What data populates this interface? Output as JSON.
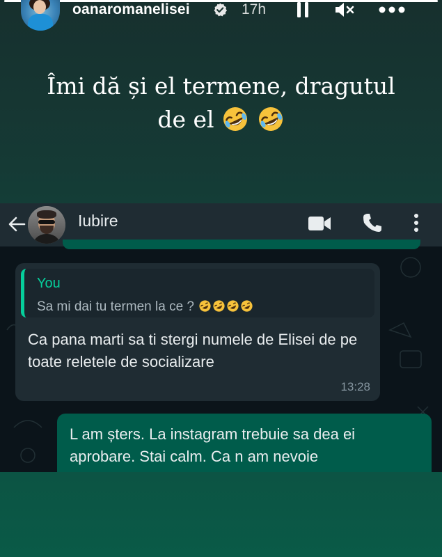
{
  "story": {
    "progress": 1.0,
    "username": "oanaromanelisei",
    "time": "17h",
    "caption_line1": "Îmi dă și el termene, dragutul",
    "caption_line2": "de el",
    "caption_emoji": "rolling-on-floor-laughing"
  },
  "icons": {
    "verified": "verified-badge-icon",
    "pause": "pause-icon",
    "mute": "mute-icon",
    "more": "more-icon"
  },
  "whatsapp": {
    "contact_name": "Iubire",
    "quote": {
      "author": "You",
      "text": "Sa mi dai tu termen la ce ?"
    },
    "incoming": {
      "text": "Ca pana marti sa ti stergi numele de Elisei de pe toate reletele de socializare",
      "time": "13:28"
    },
    "outgoing": {
      "text": "L am șters. La instagram trebuie sa dea ei aprobare. Stai calm. Ca n am nevoie"
    }
  },
  "colors": {
    "accent_green": "#06cf9c",
    "outgoing_bubble": "#005c4b",
    "incoming_bubble": "#1f2c33",
    "header_bar": "#1f2c33"
  }
}
